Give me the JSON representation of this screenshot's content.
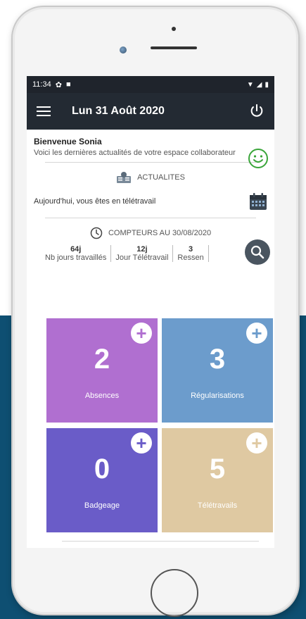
{
  "statusbar": {
    "time": "11:34",
    "icon1": "gear-icon",
    "icon2": "notification-icon",
    "right_icons": [
      "wifi-icon",
      "signal-icon",
      "battery-icon"
    ]
  },
  "appbar": {
    "title": "Lun 31 Août 2020",
    "menu_icon": "hamburger-icon",
    "power_icon": "power-icon"
  },
  "welcome": {
    "title": "Bienvenue Sonia",
    "message": "Voici les dernières actualités de votre espace collaborateur"
  },
  "news": {
    "header": "ACTUALITES",
    "status": "Aujourd'hui, vous êtes en télétravail"
  },
  "counters": {
    "header": "COMPTEURS AU 30/08/2020",
    "items": [
      {
        "value": "64j",
        "label": "Nb jours travaillés"
      },
      {
        "value": "12j",
        "label": "Jour Télétravail"
      },
      {
        "value": "3",
        "label": "Ressen"
      }
    ]
  },
  "tiles": [
    {
      "count": "2",
      "label": "Absences",
      "color": "#b06fd0"
    },
    {
      "count": "3",
      "label": "Régularisations",
      "color": "#6c9ccc"
    },
    {
      "count": "0",
      "label": "Badgeage",
      "color": "#6a5cc8"
    },
    {
      "count": "5",
      "label": "Télétravails",
      "color": "#dfc9a2"
    }
  ],
  "colors": {
    "appbar": "#232a33",
    "background_block": "#0e4f72",
    "smiley": "#3aa53a"
  }
}
